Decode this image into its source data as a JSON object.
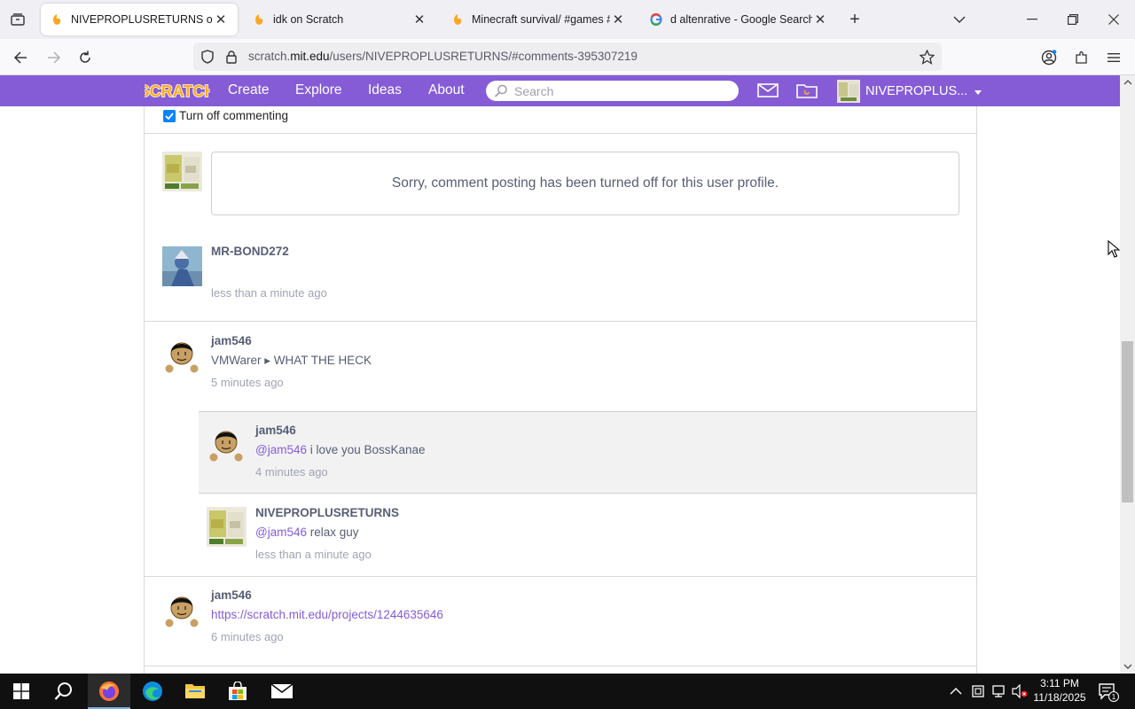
{
  "browser": {
    "tabs": [
      {
        "title": "NIVEPROPLUSRETURNS on Scratch",
        "active": true,
        "favicon": "scratch-favicon"
      },
      {
        "title": "idk on Scratch",
        "active": false,
        "favicon": "scratch-favicon"
      },
      {
        "title": "Minecraft survival/ #games #trending",
        "active": false,
        "favicon": "scratch-favicon"
      },
      {
        "title": "d altenrative - Google Search",
        "active": false,
        "favicon": "google-favicon"
      }
    ],
    "url_prefix": "scratch.",
    "url_domain": "mit.edu",
    "url_path": "/users/NIVEPROPLUSRETURNS/#comments-395307219"
  },
  "scratch_nav": {
    "logo": "SCRATCH",
    "links": [
      "Create",
      "Explore",
      "Ideas",
      "About"
    ],
    "search_placeholder": "Search",
    "username": "NIVEPROPLUS..."
  },
  "comments_section": {
    "turn_off_label": "Turn off commenting",
    "turn_off_checked": true,
    "notice": "Sorry, comment posting has been turned off for this user profile.",
    "comments": [
      {
        "user": "MR-BOND272",
        "text": "",
        "time": "less than a minute ago"
      },
      {
        "user": "jam546",
        "text": "VMWarer ▸  WHAT THE HECK",
        "time": "5 minutes ago",
        "replies": [
          {
            "user": "jam546",
            "mention": "@jam546",
            "text": " i love you BossKanae",
            "time": "4 minutes ago"
          },
          {
            "user": "NIVEPROPLUSRETURNS",
            "mention": "@jam546",
            "text": " relax guy",
            "time": "less than a minute ago"
          }
        ]
      },
      {
        "user": "jam546",
        "link": "https://scratch.mit.edu/projects/1244635646",
        "time": "6 minutes ago"
      }
    ]
  },
  "taskbar": {
    "time": "3:11 PM",
    "date": "11/18/2025",
    "notification_count": "1"
  },
  "colors": {
    "scratch_purple": "#855cd6",
    "text": "#575e75",
    "timestamp": "#a0a4b3",
    "reply_bg": "#f2f2f2"
  }
}
